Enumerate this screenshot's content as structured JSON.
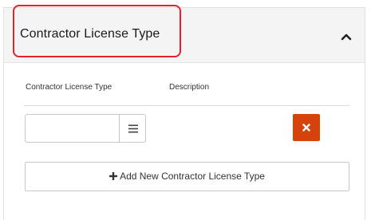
{
  "panel": {
    "title": "Contractor License Type",
    "toggle_icon": "chevron-up-icon"
  },
  "table": {
    "columns": [
      {
        "label": "Contractor License Type"
      },
      {
        "label": "Description"
      }
    ],
    "rows": [
      {
        "license_type_value": "",
        "lookup_icon": "list-icon",
        "description": "",
        "delete_icon": "close-icon"
      }
    ]
  },
  "add_button": {
    "icon": "plus-icon",
    "label": "Add New Contractor License Type"
  },
  "colors": {
    "highlight": "#e8202a",
    "delete_button": "#d6420b",
    "header_background": "#f4f4f4"
  }
}
